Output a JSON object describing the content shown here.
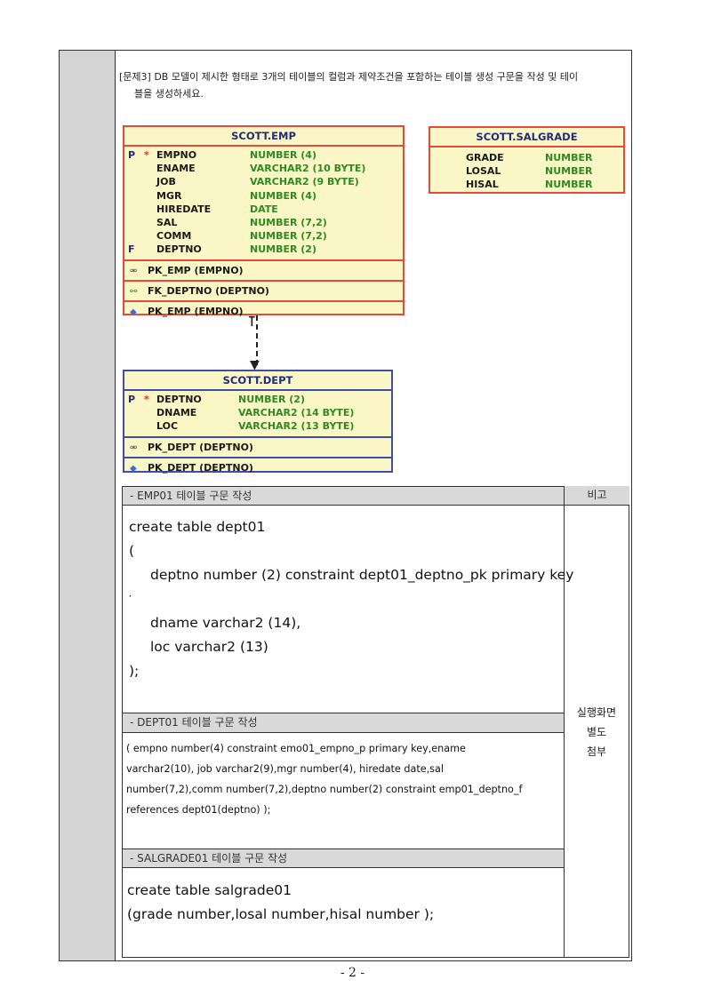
{
  "question": {
    "line1": "[문제3] DB 모델이 제시한 형태로 3개의 테이블의 컬럼과 제약조건을 포함하는 테이블 생성 구문을 작성 및 테이",
    "line2": "블을 생성하세요."
  },
  "emp": {
    "title": "SCOTT.EMP",
    "columns": [
      {
        "flag": "P",
        "star": "*",
        "name": "EMPNO",
        "type": "NUMBER (4)"
      },
      {
        "flag": "",
        "star": "",
        "name": "ENAME",
        "type": "VARCHAR2 (10 BYTE)"
      },
      {
        "flag": "",
        "star": "",
        "name": "JOB",
        "type": "VARCHAR2 (9 BYTE)"
      },
      {
        "flag": "",
        "star": "",
        "name": "MGR",
        "type": "NUMBER (4)"
      },
      {
        "flag": "",
        "star": "",
        "name": "HIREDATE",
        "type": "DATE"
      },
      {
        "flag": "",
        "star": "",
        "name": "SAL",
        "type": "NUMBER (7,2)"
      },
      {
        "flag": "",
        "star": "",
        "name": "COMM",
        "type": "NUMBER (7,2)"
      },
      {
        "flag": "F",
        "star": "",
        "name": "DEPTNO",
        "type": "NUMBER (2)"
      }
    ],
    "constraints": [
      {
        "icon": "key-icon",
        "label": "PK_EMP (EMPNO)"
      },
      {
        "icon": "foreign-key-icon",
        "label": "FK_DEPTNO (DEPTNO)"
      },
      {
        "icon": "index-icon",
        "label": "PK_EMP (EMPNO)"
      }
    ]
  },
  "salgrade": {
    "title": "SCOTT.SALGRADE",
    "columns": [
      {
        "name": "GRADE",
        "type": "NUMBER"
      },
      {
        "name": "LOSAL",
        "type": "NUMBER"
      },
      {
        "name": "HISAL",
        "type": "NUMBER"
      }
    ]
  },
  "dept": {
    "title": "SCOTT.DEPT",
    "columns": [
      {
        "flag": "P",
        "star": "*",
        "name": "DEPTNO",
        "type": "NUMBER (2)"
      },
      {
        "flag": "",
        "star": "",
        "name": "DNAME",
        "type": "VARCHAR2 (14 BYTE)"
      },
      {
        "flag": "",
        "star": "",
        "name": "LOC",
        "type": "VARCHAR2 (13 BYTE)"
      }
    ],
    "constraints": [
      {
        "icon": "key-icon",
        "label": "PK_DEPT (DEPTNO)"
      },
      {
        "icon": "index-icon",
        "label": "PK_DEPT (DEPTNO)"
      }
    ]
  },
  "answers": {
    "bigo_header": "비고",
    "note": [
      "실행화면",
      "별도",
      "첨부"
    ],
    "sec1": {
      "header": "- EMP01 테이블 구문 작성",
      "lines": [
        "create table dept01",
        "(",
        "deptno number (2) constraint dept01_deptno_pk primary key",
        ",",
        "dname varchar2 (14),",
        "loc varchar2 (13)",
        ");"
      ]
    },
    "sec2": {
      "header": "- DEPT01 테이블 구문 작성",
      "lines": [
        "( empno number(4) constraint emo01_empno_p primary key,ename",
        "varchar2(10), job varchar2(9),mgr number(4), hiredate date,sal",
        "number(7,2),comm number(7,2),deptno number(2) constraint emp01_deptno_f",
        "references dept01(deptno) );"
      ]
    },
    "sec3": {
      "header": "- SALGRADE01 테이블 구문 작성",
      "lines": [
        "create table salgrade01",
        "(grade number,losal number,hisal number );"
      ]
    }
  },
  "page_number": "- 2 -"
}
